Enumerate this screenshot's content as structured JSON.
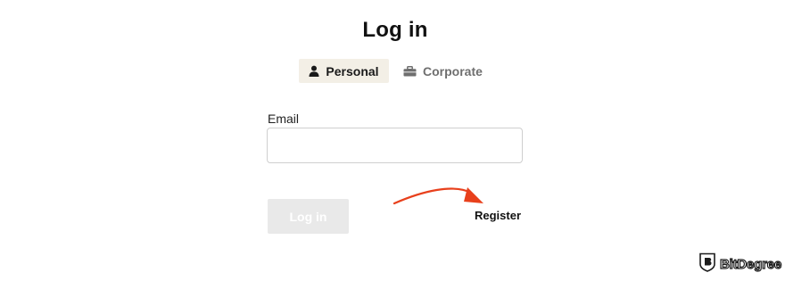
{
  "page": {
    "title": "Log in"
  },
  "tabs": [
    {
      "label": "Personal",
      "icon": "person-icon",
      "active": true
    },
    {
      "label": "Corporate",
      "icon": "briefcase-icon",
      "active": false
    }
  ],
  "form": {
    "email_label": "Email",
    "email_value": "",
    "email_placeholder": "",
    "login_label": "Log in",
    "register_label": "Register"
  },
  "annotation": {
    "arrow_color": "#e8401c"
  },
  "watermark": {
    "text": "BitDegree"
  },
  "colors": {
    "active_tab_bg": "#f3efe6",
    "disabled_button_bg": "#e9e9e9",
    "inactive_tab_text": "#6f6f6f"
  }
}
